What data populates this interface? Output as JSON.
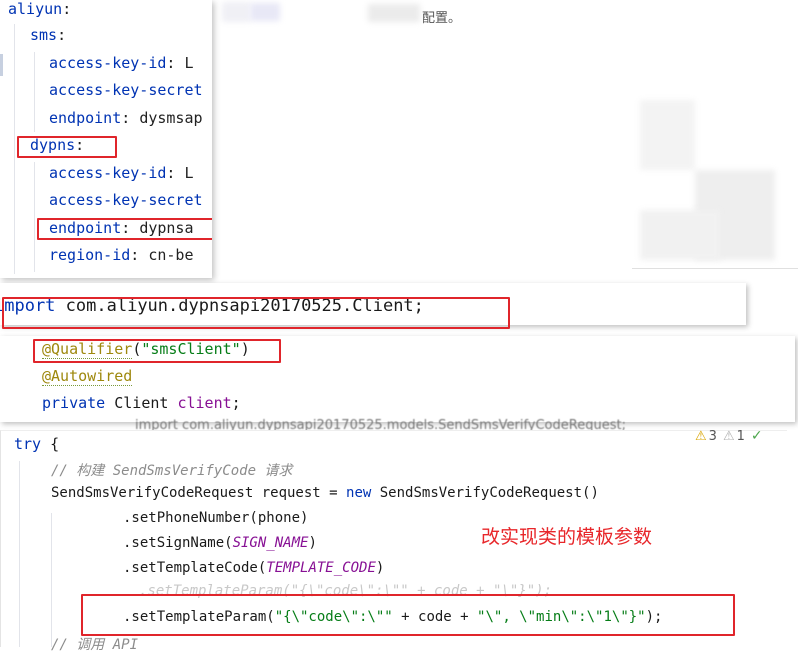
{
  "background_doc": {
    "partial_heading": "配置。",
    "overlap_import_text": "import com.aliyun.dypnsapi20170525.models.SendSmsVerifyCodeRequest;"
  },
  "yaml": {
    "lines": [
      {
        "key": "aliyun",
        "value": ""
      },
      {
        "key": "sms",
        "value": ""
      },
      {
        "key": "access-key-id",
        "value": "L"
      },
      {
        "key": "access-key-secret",
        "value": ""
      },
      {
        "key": "endpoint",
        "value": "dysmsap"
      },
      {
        "key": "dypns",
        "value": ""
      },
      {
        "key": "access-key-id",
        "value": "L"
      },
      {
        "key": "access-key-secret",
        "value": ""
      },
      {
        "key": "endpoint",
        "value": "dypnsa"
      },
      {
        "key": "region-id",
        "value": "cn-be"
      }
    ]
  },
  "import_line": {
    "keyword": "import",
    "path": "com.aliyun.dypnsapi20170525.Client;"
  },
  "annotations": {
    "qualifier": "@Qualifier",
    "qualifier_open": "(",
    "qualifier_arg": "\"smsClient\"",
    "qualifier_close": ")",
    "autowired": "@Autowired",
    "field_modifier": "private",
    "field_type": "Client",
    "field_name": "client",
    "field_end": ";"
  },
  "code": {
    "try_kw": "try",
    "try_brace": " {",
    "comment_build": "// 构建 SendSmsVerifyCode 请求",
    "decl_type": "SendSmsVerifyCodeRequest request = ",
    "decl_new": "new",
    "decl_ctor": " SendSmsVerifyCodeRequest()",
    "set_phone": ".setPhoneNumber(phone)",
    "set_sign_pre": ".setSignName(",
    "set_sign_const": "SIGN_NAME",
    "set_sign_post": ")",
    "set_tpl_pre": ".setTemplateCode(",
    "set_tpl_const": "TEMPLATE_CODE",
    "set_tpl_post": ")",
    "old_param": ".setTemplateParam(\"{\\\"code\\\":\\\"\" + code + \"\\\"}\");",
    "new_param_a": ".setTemplateParam(",
    "new_param_b": "\"{\\\"code\\\":\\\"\"",
    "new_param_c": " + code + ",
    "new_param_d": "\"\\\", \\\"min\\\":\\\"1\\\"}\"",
    "new_param_e": ");",
    "comment_call": "// 调用 API",
    "note": "改实现类的模板参数"
  },
  "inspections": {
    "warnings": "3",
    "weak_warnings": "1"
  },
  "colors": {
    "highlight_box": "#e0252b",
    "keyword": "#0033b3",
    "annotation": "#9e880d",
    "string": "#067d17",
    "field": "#871094"
  }
}
